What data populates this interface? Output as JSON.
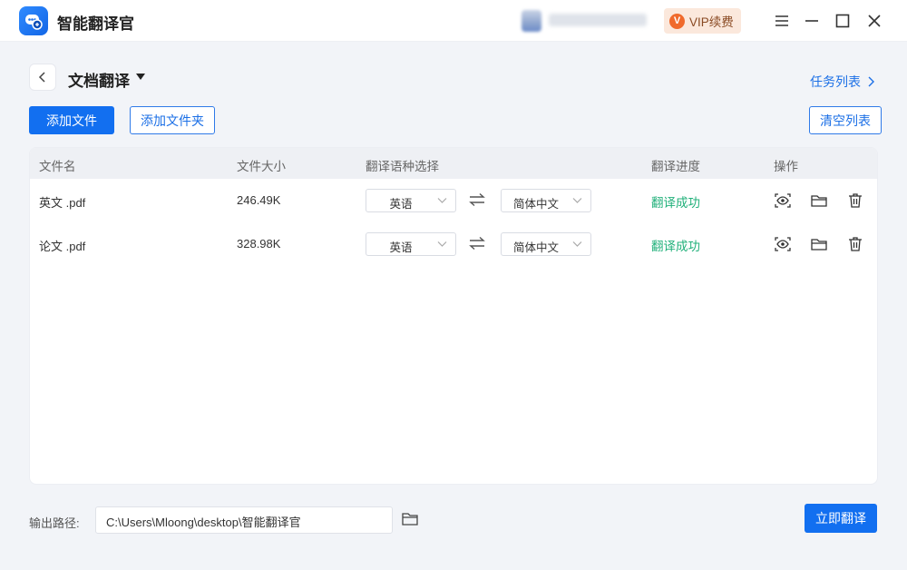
{
  "app": {
    "title": "智能翻译官"
  },
  "titlebar": {
    "vip_label": "VIP续费",
    "vip_badge": "V"
  },
  "page": {
    "title": "文档翻译",
    "task_list_label": "任务列表"
  },
  "toolbar": {
    "add_file_label": "添加文件",
    "add_folder_label": "添加文件夹",
    "clear_list_label": "清空列表"
  },
  "table": {
    "headers": {
      "name": "文件名",
      "size": "文件大小",
      "language": "翻译语种选择",
      "progress": "翻译进度",
      "actions": "操作"
    },
    "rows": [
      {
        "name": "英文 .pdf",
        "size": "246.49K",
        "source_lang": "英语",
        "target_lang": "简体中文",
        "status": "翻译成功"
      },
      {
        "name": "论文 .pdf",
        "size": "328.98K",
        "source_lang": "英语",
        "target_lang": "简体中文",
        "status": "翻译成功"
      }
    ]
  },
  "footer": {
    "output_label": "输出路径:",
    "output_path": "C:\\Users\\Mloong\\desktop\\智能翻译官",
    "translate_now_label": "立即翻译"
  },
  "colors": {
    "accent": "#126ff0",
    "success": "#21b07a",
    "vip_bg": "#fbe8dc"
  },
  "icons": [
    "app-logo-icon",
    "chevron-left-icon",
    "caret-down-icon",
    "chevron-right-icon",
    "swap-icon",
    "chevron-down-icon",
    "preview-eye-icon",
    "open-folder-icon",
    "trash-icon",
    "minimize-icon",
    "maximize-icon",
    "close-icon",
    "menu-icon"
  ]
}
